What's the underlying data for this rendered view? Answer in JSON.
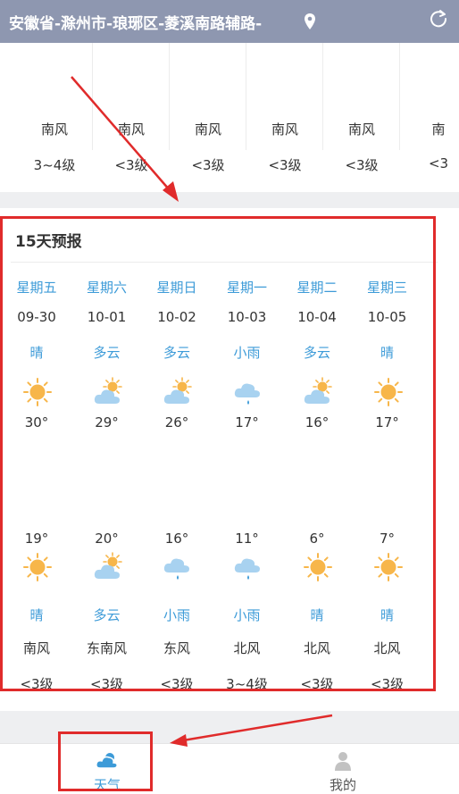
{
  "header": {
    "location": "安徽省-滁州市-琅琊区-菱溪南路辅路-",
    "pin_icon": "location-pin-icon",
    "refresh_icon": "refresh-icon"
  },
  "wind_strip": [
    {
      "dir": "南风",
      "level": "3~4级"
    },
    {
      "dir": "南风",
      "level": "<3级"
    },
    {
      "dir": "南风",
      "level": "<3级"
    },
    {
      "dir": "南风",
      "level": "<3级"
    },
    {
      "dir": "南风",
      "level": "<3级"
    },
    {
      "dir": "南",
      "level": "<3"
    }
  ],
  "forecast": {
    "title": "15天预报",
    "days": [
      {
        "weekday": "星期五",
        "date": "09-30",
        "day_weather": "晴",
        "day_icon": "sun-icon",
        "high": "30°",
        "low": "19°",
        "night_icon": "sun-icon",
        "night_weather": "晴",
        "wind_dir": "南风",
        "wind_level": "<3级"
      },
      {
        "weekday": "星期六",
        "date": "10-01",
        "day_weather": "多云",
        "day_icon": "partly-cloudy-icon",
        "high": "29°",
        "low": "20°",
        "night_icon": "partly-cloudy-icon",
        "night_weather": "多云",
        "wind_dir": "东南风",
        "wind_level": "<3级"
      },
      {
        "weekday": "星期日",
        "date": "10-02",
        "day_weather": "多云",
        "day_icon": "partly-cloudy-icon",
        "high": "26°",
        "low": "16°",
        "night_icon": "light-rain-icon",
        "night_weather": "小雨",
        "wind_dir": "东风",
        "wind_level": "<3级"
      },
      {
        "weekday": "星期一",
        "date": "10-03",
        "day_weather": "小雨",
        "day_icon": "light-rain-icon",
        "high": "17°",
        "low": "11°",
        "night_icon": "light-rain-icon",
        "night_weather": "小雨",
        "wind_dir": "北风",
        "wind_level": "3~4级"
      },
      {
        "weekday": "星期二",
        "date": "10-04",
        "day_weather": "多云",
        "day_icon": "partly-cloudy-icon",
        "high": "16°",
        "low": "6°",
        "night_icon": "sun-icon",
        "night_weather": "晴",
        "wind_dir": "北风",
        "wind_level": "<3级"
      },
      {
        "weekday": "星期三",
        "date": "10-05",
        "day_weather": "晴",
        "day_icon": "sun-icon",
        "high": "17°",
        "low": "7°",
        "night_icon": "sun-icon",
        "night_weather": "晴",
        "wind_dir": "北风",
        "wind_level": "<3级"
      }
    ]
  },
  "tabbar": {
    "weather_label": "天气",
    "weather_icon": "cloud-weather-icon",
    "mine_label": "我的",
    "mine_icon": "user-icon"
  },
  "colors": {
    "header_bg": "#8e97b0",
    "accent_blue": "#3d9bd8",
    "annotation_red": "#e02b2b",
    "sun": "#f7b64a"
  }
}
